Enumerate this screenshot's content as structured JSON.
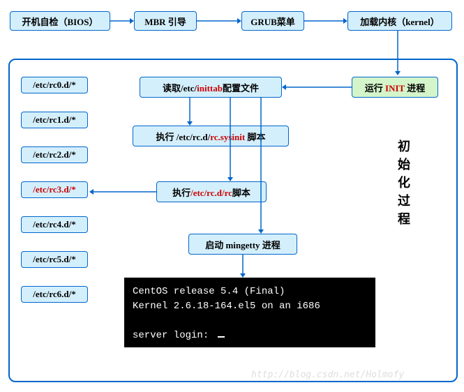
{
  "top": {
    "bios": {
      "pre": "开机自检（",
      "em": "BIOS",
      "post": "）"
    },
    "mbr": "MBR 引导",
    "grub": "GRUB菜单",
    "kernel": {
      "pre": "加载内核（",
      "em": "kernel",
      "post": "）"
    }
  },
  "main": {
    "init": {
      "pre": "运行 ",
      "em": "INIT",
      "post": " 进程"
    },
    "inittab": {
      "pre": "读取/etc/",
      "em": "inittab",
      "post": "配置文件"
    },
    "sysinit": {
      "pre": "执行 /etc/rc.d/",
      "em": "rc.sysinit",
      "post": " 脚本"
    },
    "rc": {
      "pre": "执行",
      "em": "/etc/rc.d/rc",
      "post": "脚本"
    },
    "mingetty": "启动 mingetty 进程"
  },
  "side_label": "初始化过程",
  "rc_dirs": [
    "/etc/rc0.d/*",
    "/etc/rc1.d/*",
    "/etc/rc2.d/*",
    "/etc/rc3.d/*",
    "/etc/rc4.d/*",
    "/etc/rc5.d/*",
    "/etc/rc6.d/*"
  ],
  "rc_highlight_index": 3,
  "terminal": {
    "line1": "CentOS release 5.4 (Final)",
    "line2": "Kernel 2.6.18-164.el5 on an i686",
    "prompt": "server login: "
  },
  "watermark": "http://blog.csdn.net/Holmofy"
}
